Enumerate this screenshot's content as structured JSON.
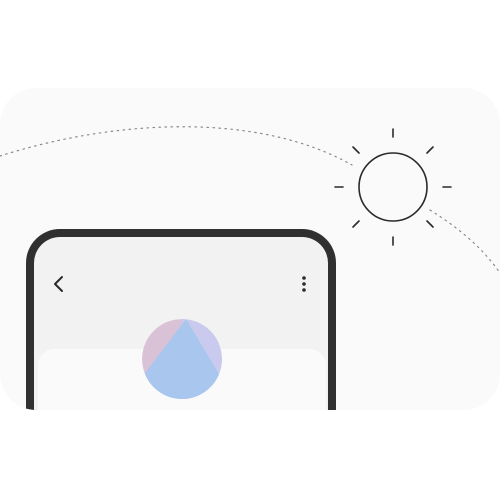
{
  "illustration": {
    "sun_icon": "sun-icon",
    "orbit_path": "dotted-arc"
  },
  "phone": {
    "toolbar": {
      "back_icon": "chevron-left-icon",
      "more_icon": "more-vertical-icon"
    },
    "profile": {
      "avatar_icon": "avatar-gradient-circle",
      "colors": [
        "#d9c2d6",
        "#c9caee",
        "#a9c6ee"
      ]
    }
  },
  "colors": {
    "background": "#ffffff",
    "card": "#fafafa",
    "phone_frame": "#303030",
    "screen": "#f2f2f2"
  }
}
